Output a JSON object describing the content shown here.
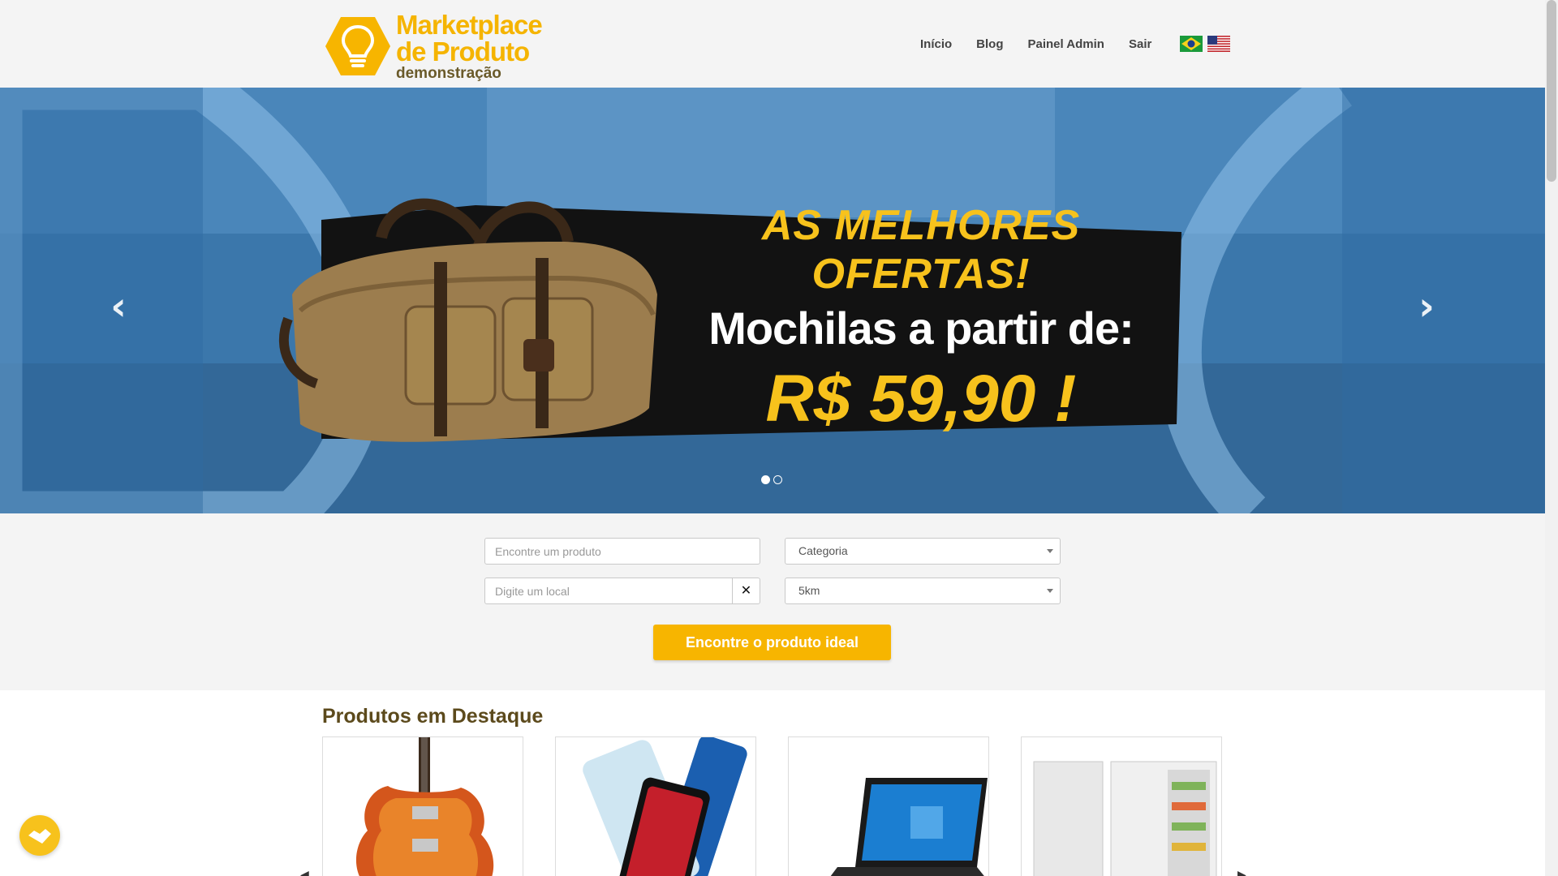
{
  "header": {
    "logo": {
      "line1": "Marketplace",
      "line2": "de Produto",
      "line3": "demonstração",
      "icon": "lightbulb-hexagon-icon"
    },
    "nav": [
      {
        "label": "Início"
      },
      {
        "label": "Blog"
      },
      {
        "label": "Painel Admin"
      },
      {
        "label": "Sair"
      }
    ],
    "flags": [
      "brazil-flag-icon",
      "usa-flag-icon"
    ]
  },
  "hero": {
    "title": "AS MELHORES OFERTAS!",
    "subtitle": "Mochilas a partir de:",
    "price": "R$ 59,90 !",
    "slide_count": 2,
    "active_slide": 1
  },
  "search": {
    "product_placeholder": "Encontre um produto",
    "category_value": "Categoria",
    "location_placeholder": "Digite um local",
    "clear_symbol": "✕",
    "radius_value": "5km",
    "submit_label": "Encontre o produto ideal"
  },
  "featured": {
    "title": "Produtos em Destaque",
    "products": [
      {
        "image": "electric-guitar"
      },
      {
        "image": "smartphones"
      },
      {
        "image": "laptop"
      },
      {
        "image": "freezers"
      }
    ]
  },
  "colors": {
    "brand_yellow": "#f7b500",
    "brand_brown": "#5c4a1c",
    "hero_blue": "#3e79ad"
  }
}
